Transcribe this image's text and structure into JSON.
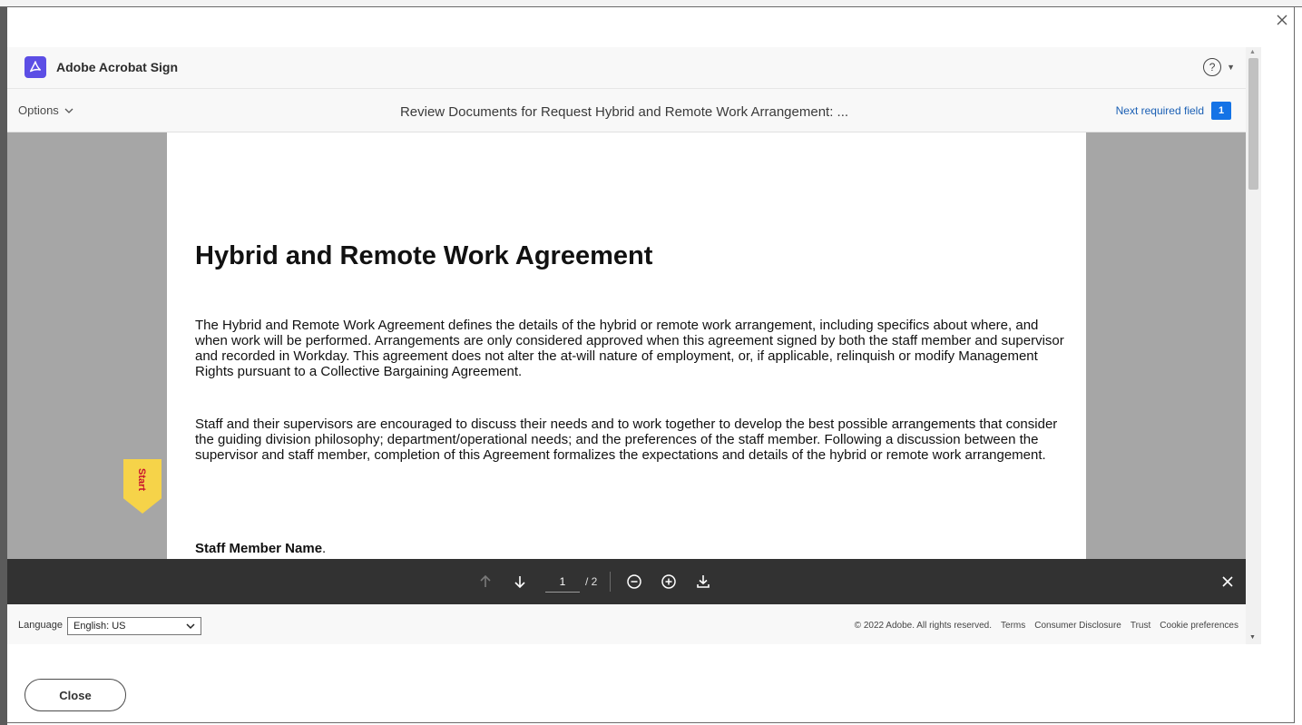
{
  "app": {
    "name": "Adobe Acrobat Sign"
  },
  "toolbar": {
    "options_label": "Options",
    "title": "Review Documents for Request Hybrid and Remote Work Arrangement: ...",
    "next_field_label": "Next required field",
    "next_field_count": "1"
  },
  "document": {
    "title": "Hybrid and Remote Work Agreement",
    "paragraph1": "The Hybrid and Remote Work Agreement defines the details of the hybrid or remote work arrangement, including specifics about where, and when work will be performed. Arrangements are only considered approved when this agreement signed by both the staff member and supervisor and recorded in Workday. This agreement does not alter the at-will nature of employment, or, if applicable, relinquish or modify Management Rights pursuant to a Collective Bargaining Agreement.",
    "paragraph2": "Staff and their supervisors are encouraged to discuss their needs and to work together to develop the best possible arrangements that consider the guiding division philosophy; department/operational needs; and the preferences of the staff member. Following a discussion between the supervisor and staff member, completion of this Agreement formalizes the expectations and details of the hybrid or remote work arrangement.",
    "field_label": "Staff Member Name",
    "field_label_suffix": "."
  },
  "start_tag": {
    "label": "Start"
  },
  "pager": {
    "current_page": "1",
    "total": "/ 2"
  },
  "footer": {
    "language_label": "Language",
    "language_value": "English: US",
    "copyright": "© 2022 Adobe. All rights reserved.",
    "links": [
      "Terms",
      "Consumer Disclosure",
      "Trust",
      "Cookie preferences"
    ]
  },
  "modal": {
    "close_label": "Close"
  },
  "colors": {
    "brand": "#5c4ee5",
    "accent_blue": "#1473e6",
    "start_tag": "#f6d349",
    "bottom_bar": "#323232",
    "doc_background": "#a6a6a6"
  },
  "icons": {
    "brand": "acrobat-logo-icon",
    "help": "question-circle-icon",
    "prev": "arrow-up-icon",
    "next": "arrow-down-icon",
    "zoom_out": "zoom-out-icon",
    "zoom_in": "zoom-in-icon",
    "download": "download-icon",
    "close": "close-icon"
  }
}
